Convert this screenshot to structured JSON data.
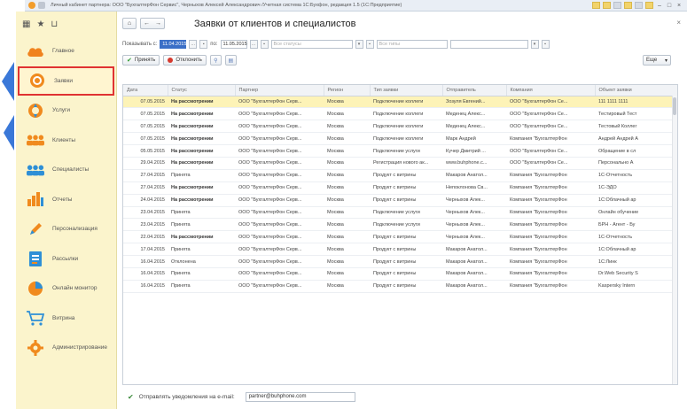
{
  "window": {
    "title": "Личный кабинет партнера: ООО \"БухгалтерФон Сервис\", Черныхов Алексей Александрович /Учетная система 1С:Бухфон, редакция 1.5 (1С:Предприятие)"
  },
  "sidebar": {
    "items": [
      {
        "label": "Главное",
        "icon": "cloud-icon"
      },
      {
        "label": "Заявки",
        "icon": "target-icon",
        "active": true
      },
      {
        "label": "Услуги",
        "icon": "lifebuoy-icon"
      },
      {
        "label": "Клиенты",
        "icon": "group-icon"
      },
      {
        "label": "Специалисты",
        "icon": "team-icon"
      },
      {
        "label": "Отчеты",
        "icon": "bar-chart-icon"
      },
      {
        "label": "Персонализация",
        "icon": "pencil-icon"
      },
      {
        "label": "Рассылки",
        "icon": "document-icon"
      },
      {
        "label": "Онлайн монитор",
        "icon": "pie-chart-icon"
      },
      {
        "label": "Витрина",
        "icon": "cart-icon"
      },
      {
        "label": "Администрирование",
        "icon": "gear-icon"
      }
    ]
  },
  "header": {
    "title": "Заявки от клиентов и специалистов",
    "close": "×"
  },
  "filters": {
    "show_from_label": "Показывать с:",
    "date_from": "11.04.2015",
    "to_label": "по:",
    "date_to": "11.05.2015",
    "status_placeholder": "Все статусы",
    "type_placeholder": "Все типы",
    "extra_placeholder": ""
  },
  "toolbar": {
    "accept_label": "Принять",
    "reject_label": "Отклонить",
    "more_label": "Еще"
  },
  "table": {
    "columns": [
      "Дата",
      "Статус",
      "Партнер",
      "Регион",
      "Тип заявки",
      "Отправитель",
      "Компания",
      "Объект заявки"
    ],
    "rows": [
      [
        "07.05.2015",
        "На рассмотрении",
        "ООО \"БухгалтерФон Серв...",
        "Москва",
        "Подключение коллеги",
        "Зозуля Евгений...",
        "ООО \"БухгалтерФон Се...",
        "111 1111 1111"
      ],
      [
        "07.05.2015",
        "На рассмотрении",
        "ООО \"БухгалтерФон Серв...",
        "Москва",
        "Подключение коллеги",
        "Меденец Алекс...",
        "ООО \"БухгалтерФон Се...",
        "Тестировый Тест"
      ],
      [
        "07.05.2015",
        "На рассмотрении",
        "ООО \"БухгалтерФон Серв...",
        "Москва",
        "Подключение коллеги",
        "Меденец Алекс...",
        "ООО \"БухгалтерФон Се...",
        "Тестовый Коллег"
      ],
      [
        "07.05.2015",
        "На рассмотрении",
        "ООО \"БухгалтерФон Серв...",
        "Москва",
        "Подключение коллеги",
        "Марк Андрей",
        "Компания \"БухгалтерФон",
        "Андрей Андрей А"
      ],
      [
        "05.05.2015",
        "На рассмотрении",
        "ООО \"БухгалтерФон Серв...",
        "Москва",
        "Подключение услуги",
        "Кучер Дмитрий ...",
        "ООО \"БухгалтерФон Се...",
        "Обращение в сл"
      ],
      [
        "29.04.2015",
        "На рассмотрении",
        "ООО \"БухгалтерФон Серв...",
        "Москва",
        "Регистрация нового ак...",
        "www.buhphone.c...",
        "ООО \"БухгалтерФон Се...",
        "Персонально А"
      ],
      [
        "27.04.2015",
        "Принята",
        "ООО \"БухгалтерФон Серв...",
        "Москва",
        "Продукт с витрины",
        "Макаров Анатол...",
        "Компания \"БухгалтерФон",
        "1С-Отчетность"
      ],
      [
        "27.04.2015",
        "На рассмотрении",
        "ООО \"БухгалтерФон Серв...",
        "Москва",
        "Продукт с витрины",
        "Непоклонова Св...",
        "Компания \"БухгалтерФон",
        "1С-ЭДО"
      ],
      [
        "24.04.2015",
        "На рассмотрении",
        "ООО \"БухгалтерФон Серв...",
        "Москва",
        "Продукт с витрины",
        "Черныхов Алек...",
        "Компания \"БухгалтерФон",
        "1С:Облачный ар"
      ],
      [
        "23.04.2015",
        "Принята",
        "ООО \"БухгалтерФон Серв...",
        "Москва",
        "Подключение услуги",
        "Черныхов Алек...",
        "Компания \"БухгалтерФон",
        "Онлайн обучение"
      ],
      [
        "23.04.2015",
        "Принята",
        "ООО \"БухгалтерФон Серв...",
        "Москва",
        "Подключение услуги",
        "Черныхов Алек...",
        "Компания \"БухгалтерФон",
        "БРН - Агент - Бу"
      ],
      [
        "22.04.2015",
        "На рассмотрении",
        "ООО \"БухгалтерФон Серв...",
        "Москва",
        "Продукт с витрины",
        "Черныхов Алек...",
        "Компания \"БухгалтерФон",
        "1С-Отчетность"
      ],
      [
        "17.04.2015",
        "Принята",
        "ООО \"БухгалтерФон Серв...",
        "Москва",
        "Продукт с витрины",
        "Макаров Анатол...",
        "Компания \"БухгалтерФон",
        "1С:Облачный ар"
      ],
      [
        "16.04.2015",
        "Отклонена",
        "ООО \"БухгалтерФон Серв...",
        "Москва",
        "Продукт с витрины",
        "Макаров Анатол...",
        "Компания \"БухгалтерФон",
        "1С:Линк"
      ],
      [
        "16.04.2015",
        "Принята",
        "ООО \"БухгалтерФон Серв...",
        "Москва",
        "Продукт с витрины",
        "Макаров Анатол...",
        "Компания \"БухгалтерФон",
        "Dr.Web Security S"
      ],
      [
        "16.04.2015",
        "Принята",
        "ООО \"БухгалтерФон Серв...",
        "Москва",
        "Продукт с витрины",
        "Макаров Анатол...",
        "Компания \"БухгалтерФон",
        "Kaspersky Intern"
      ]
    ]
  },
  "bottom": {
    "notify_label": "Отправлять уведомления на e-mail:",
    "email": "partner@buhphone.com"
  },
  "colors": {
    "sidebar_bg": "#fbf4cc",
    "active_border": "#e03232",
    "selected_row": "#fdf3b7",
    "accent_blue": "#3b6fc7"
  }
}
